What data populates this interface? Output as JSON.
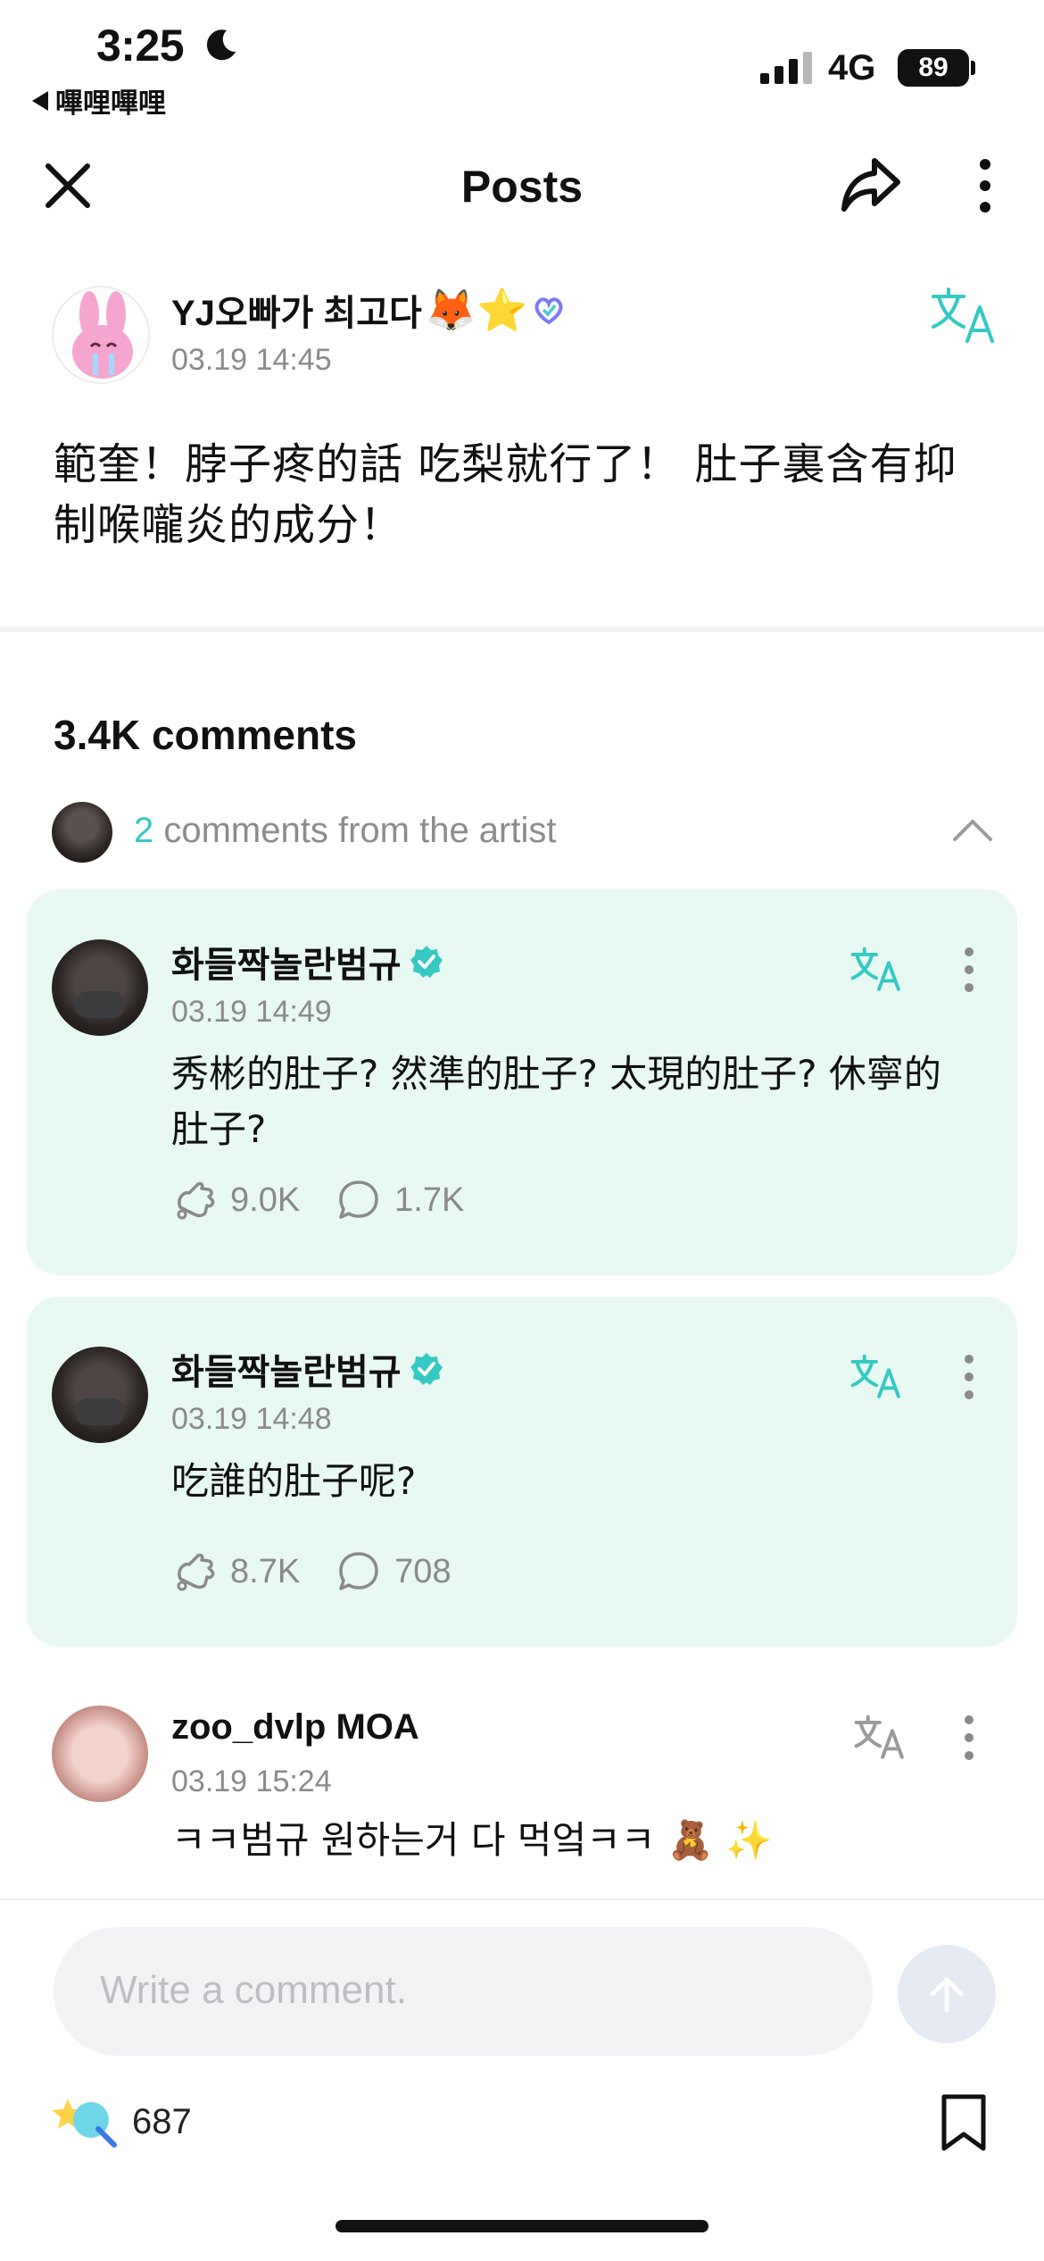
{
  "status_bar": {
    "time": "3:25",
    "back_app": "嗶哩嗶哩",
    "network": "4G",
    "battery": "89"
  },
  "header": {
    "title": "Posts"
  },
  "post": {
    "author": "YJ오빠가 최고다",
    "author_emoji": "🦊⭐",
    "date": "03.19 14:45",
    "body": "範奎！脖子疼的話 吃梨就行了！ 肚子裏含有抑制喉嚨炎的成分！"
  },
  "comments": {
    "count_label": "3.4K comments",
    "artist_count": "2",
    "artist_label": " comments from the artist",
    "items": [
      {
        "name": "화들짝놀란범규",
        "date": "03.19 14:49",
        "text": "秀彬的肚子? 然準的肚子? 太現的肚子? 休寧的肚子?",
        "likes": "9.0K",
        "replies": "1.7K"
      },
      {
        "name": "화들짝놀란범규",
        "date": "03.19 14:48",
        "text": "吃誰的肚子呢?",
        "likes": "8.7K",
        "replies": "708"
      },
      {
        "name": "zoo_dvlp MOA",
        "date": "03.19 15:24",
        "text": "ㅋㅋ범규 원하는거 다 먹엌ㅋㅋ 🧸 ✨"
      }
    ]
  },
  "composer": {
    "placeholder": "Write a comment."
  },
  "footer": {
    "like_count": "687"
  },
  "colors": {
    "accent": "#34c9c2",
    "artist_card_bg": "#e8f8f3",
    "muted_text": "#8a8a8a"
  },
  "icons": {
    "close": "close-icon",
    "share": "share-icon",
    "more": "more-vertical-icon",
    "translate": "translate-icon",
    "verified": "verified-badge-icon",
    "like": "like-icon",
    "reply": "reply-icon",
    "send": "send-arrow-icon",
    "bookmark": "bookmark-icon",
    "chevron": "chevron-up-icon"
  }
}
